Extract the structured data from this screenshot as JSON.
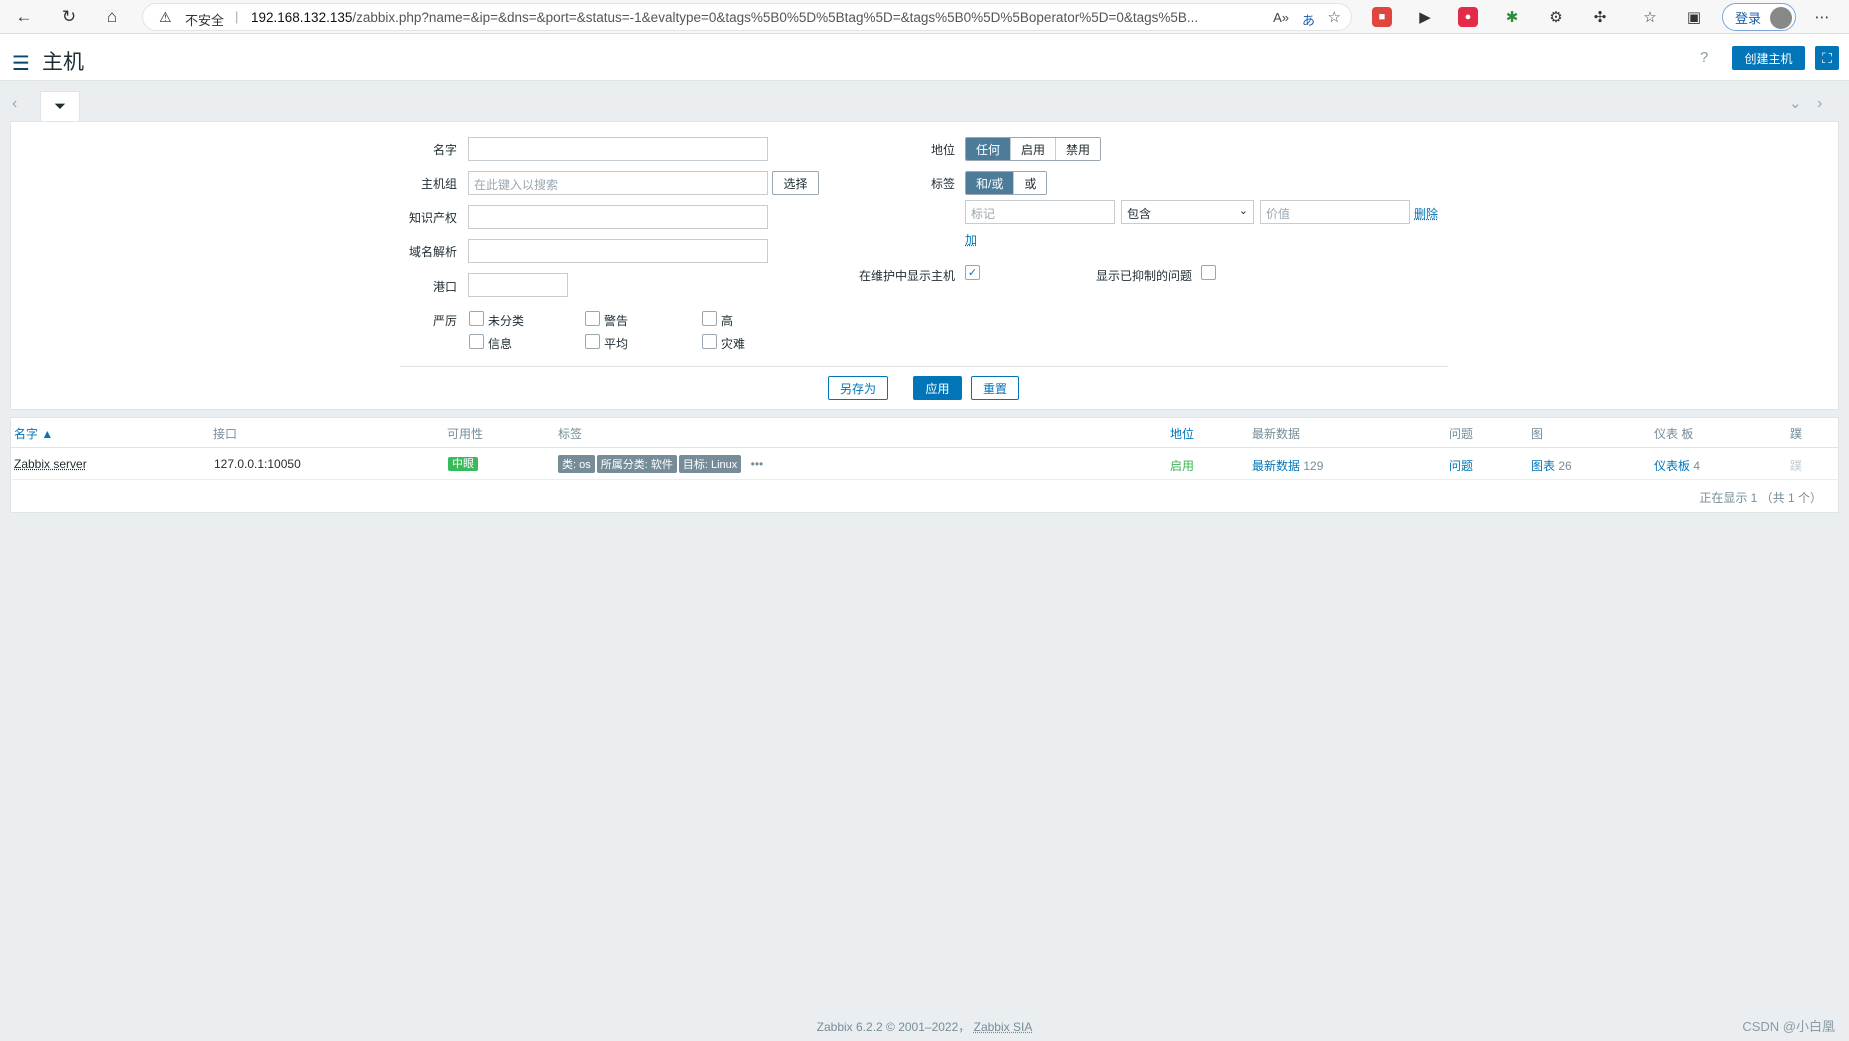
{
  "browser": {
    "security_label": "不安全",
    "url_host": "192.168.132.135",
    "url_rest": "/zabbix.php?name=&ip=&dns=&port=&status=-1&evaltype=0&tags%5B0%5D%5Btag%5D=&tags%5B0%5D%5Boperator%5D=0&tags%5B...",
    "login_label": "登录"
  },
  "header": {
    "title": "主机",
    "help": "?",
    "create_host": "创建主机"
  },
  "filter": {
    "name_label": "名字",
    "hostgroup_label": "主机组",
    "hostgroup_placeholder": "在此键入以搜索",
    "select_button": "选择",
    "ip_label": "知识产权",
    "dns_label": "域名解析",
    "port_label": "港口",
    "severity_label": "严厉",
    "severities": [
      "未分类",
      "警告",
      "高",
      "信息",
      "平均",
      "灾难"
    ],
    "status_label": "地位",
    "status_options": [
      "任何",
      "启用",
      "禁用"
    ],
    "tags_label": "标签",
    "tags_eval_options": [
      "和/或",
      "或"
    ],
    "tag_placeholder": "标记",
    "tag_operator": "包含",
    "tag_value_placeholder": "价值",
    "remove_link": "删除",
    "add_link": "加",
    "show_maintenance_label": "在维护中显示主机",
    "show_suppressed_label": "显示已抑制的问题",
    "save_as_button": "另存为",
    "apply_button": "应用",
    "reset_button": "重置"
  },
  "table": {
    "columns": [
      "名字 ▲",
      "接口",
      "可用性",
      "标签",
      "地位",
      "最新数据",
      "问题",
      "图",
      "仪表 板",
      "蹼"
    ],
    "rows": [
      {
        "name": "Zabbix server",
        "interface": "127.0.0.1:10050",
        "availability": "中眼",
        "tags": [
          "类: os",
          "所属分类: 软件",
          "目标: Linux"
        ],
        "more": "•••",
        "status": "启用",
        "latest_data": "最新数据",
        "latest_count": "129",
        "problems": "问题",
        "graphs": "图表",
        "graphs_count": "26",
        "dashboards": "仪表板",
        "dashboards_count": "4",
        "web": "蹼"
      }
    ],
    "summary": "正在显示 1 （共 1 个）"
  },
  "footer": {
    "text": "Zabbix 6.2.2 © 2001–2022，",
    "company": "Zabbix SIA"
  },
  "watermark": "CSDN @小白凰"
}
